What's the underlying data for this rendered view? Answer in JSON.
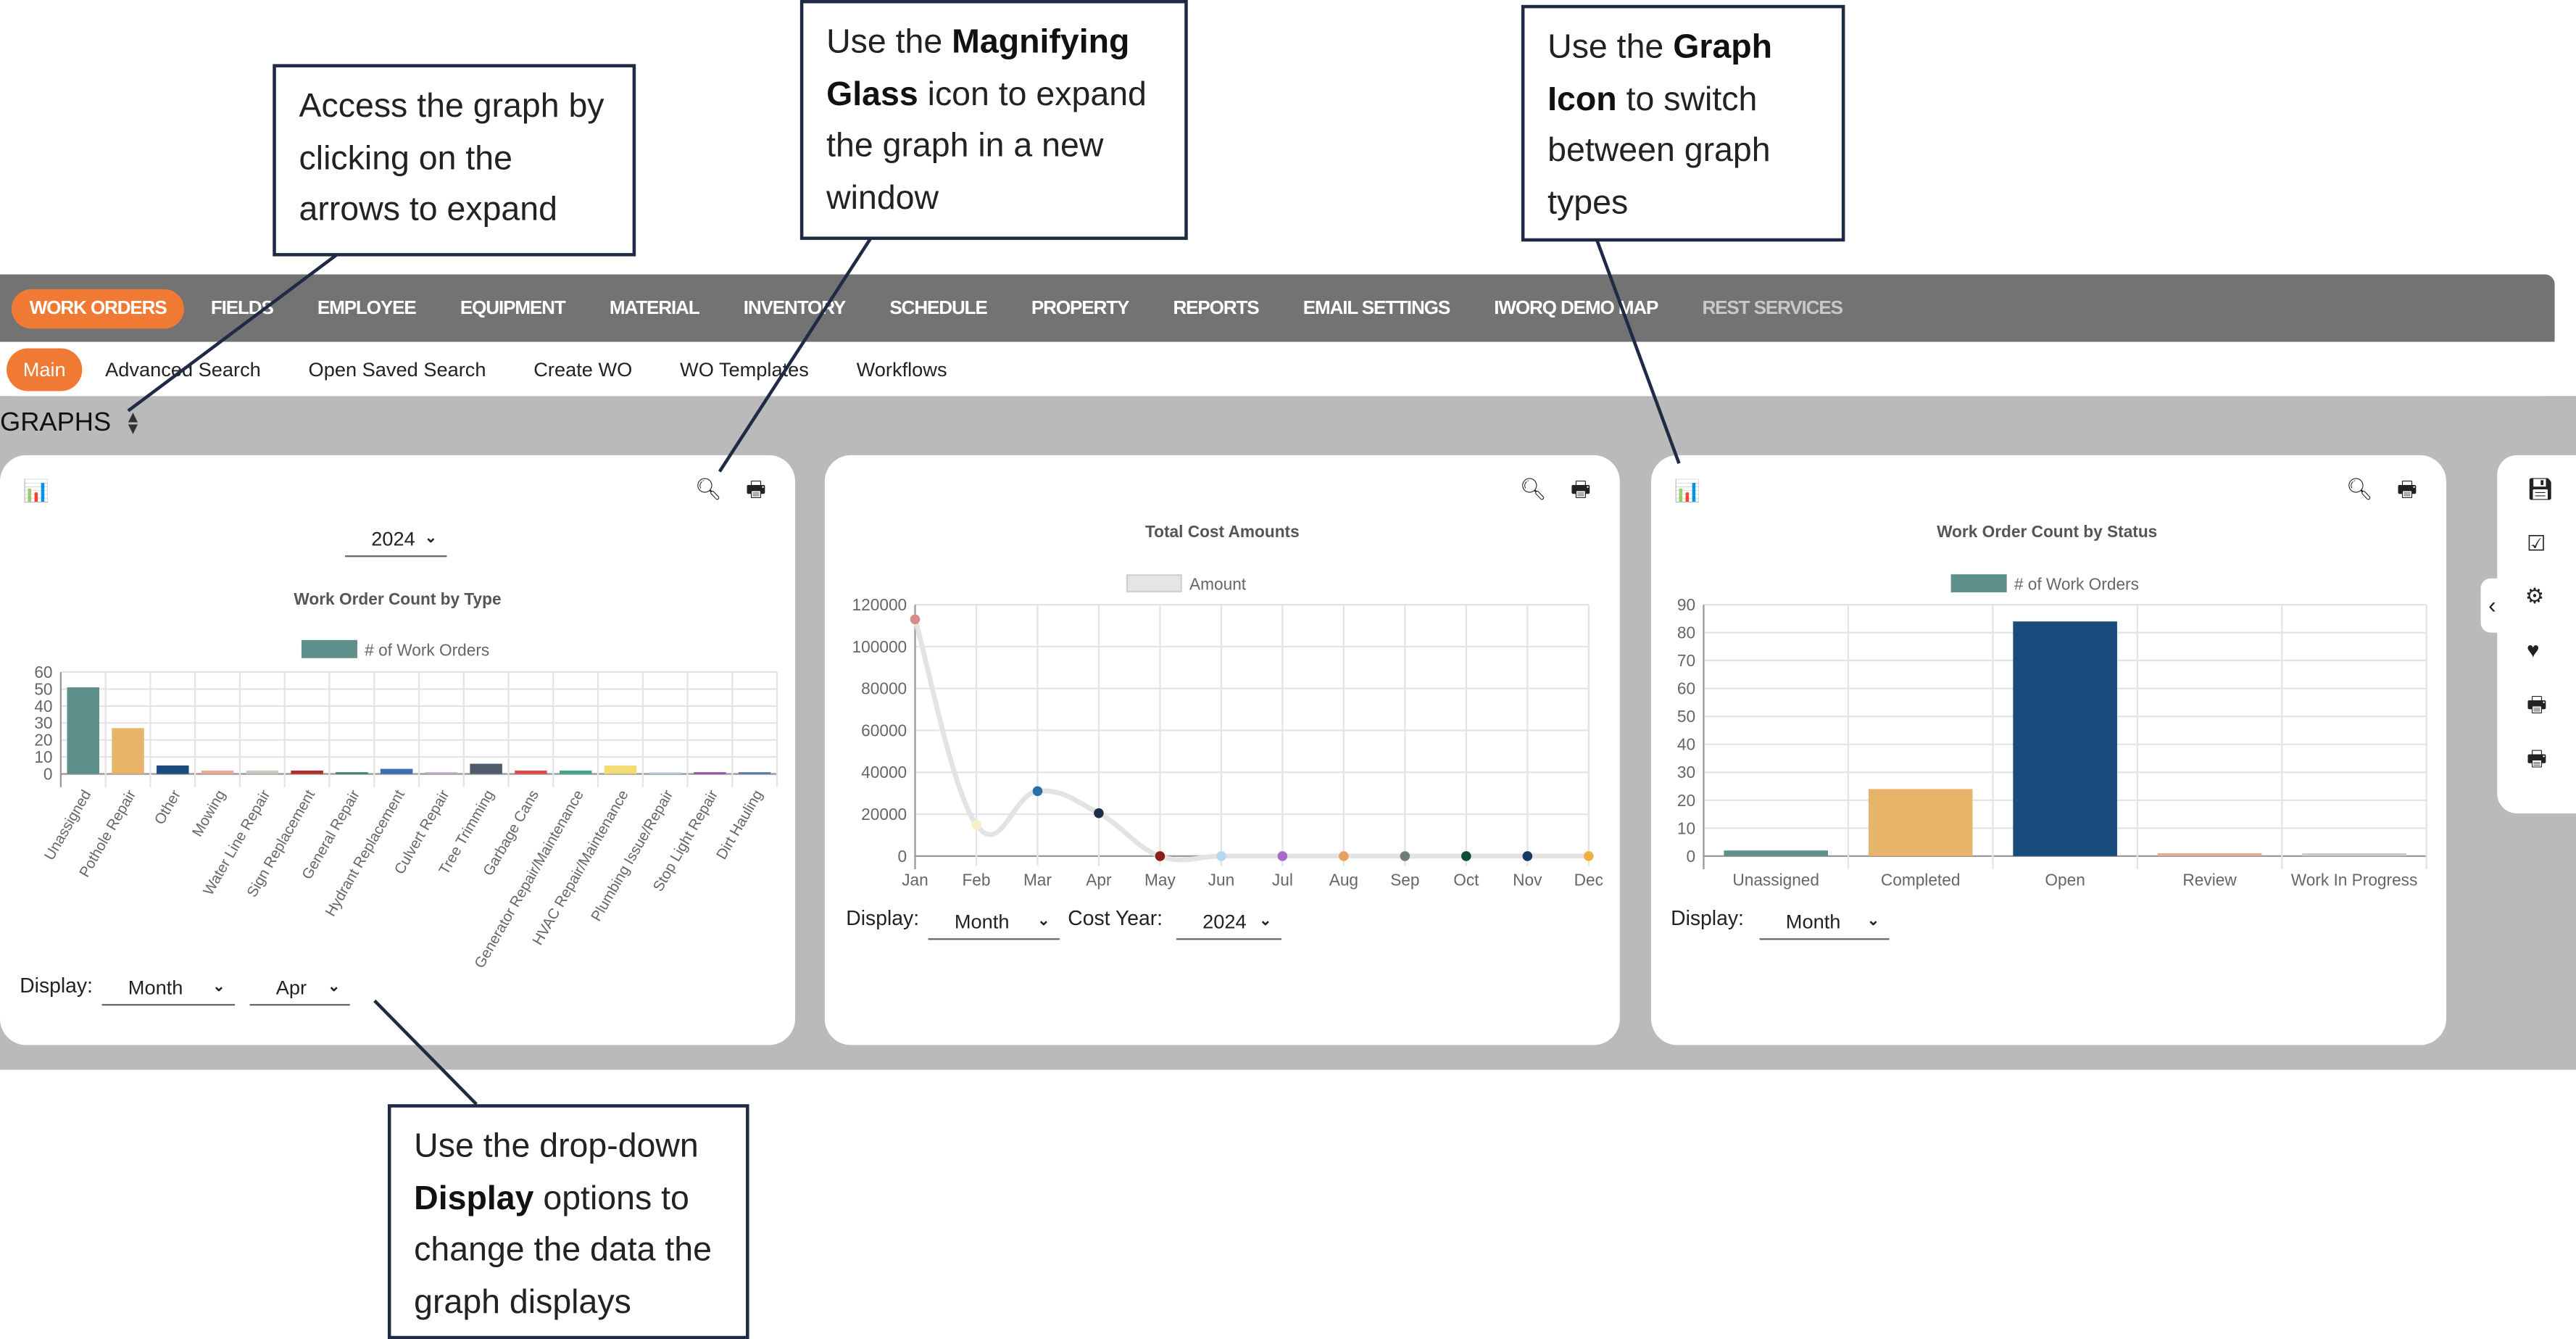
{
  "nav": {
    "items": [
      "WORK ORDERS",
      "FIELDS",
      "EMPLOYEE",
      "EQUIPMENT",
      "MATERIAL",
      "INVENTORY",
      "SCHEDULE",
      "PROPERTY",
      "REPORTS",
      "EMAIL SETTINGS",
      "IWORQ DEMO MAP",
      "REST SERVICES"
    ],
    "active": "WORK ORDERS"
  },
  "subnav": {
    "items": [
      "Main",
      "Advanced Search",
      "Open Saved Search",
      "Create WO",
      "WO Templates",
      "Workflows"
    ],
    "active": "Main"
  },
  "section_title": "GRAPHS",
  "panels": [
    {
      "year_select": "2024",
      "display_label": "Display:",
      "display_select": "Month",
      "month_select": "Apr"
    },
    {
      "display_label": "Display:",
      "display_select": "Month",
      "cost_year_label": "Cost Year:",
      "cost_year_select": "2024"
    },
    {
      "display_label": "Display:",
      "display_select": "Month"
    }
  ],
  "sidebar_icons": [
    "save-icon",
    "checkbox-icon",
    "gears-icon",
    "heart-icon",
    "print-icon",
    "print-icon"
  ],
  "callouts": [
    {
      "parts": [
        "Access the graph by clicking on the arrows to expand"
      ]
    },
    {
      "parts": [
        "Use the ",
        "Magnifying Glass",
        " icon to expand the graph in a new window"
      ]
    },
    {
      "parts": [
        "Use the ",
        "Graph Icon",
        " to switch between graph types"
      ]
    },
    {
      "parts": [
        "Use the drop-down ",
        "Display",
        " options to change the data the graph displays"
      ]
    }
  ],
  "chart_data": [
    {
      "type": "bar",
      "title": "Work Order Count by Type",
      "legend": "# of Work Orders",
      "legend_color": "#5e8f8b",
      "legend_position": "top",
      "grid": true,
      "ylim": [
        0,
        60
      ],
      "yticks": [
        0,
        10,
        20,
        30,
        40,
        50,
        60
      ],
      "categories": [
        "Unassigned",
        "Pothole Repair",
        "Other",
        "Mowing",
        "Water Line Repair",
        "Sign Replacement",
        "General Repair",
        "Hydrant Replacement",
        "Culvert Repair",
        "Tree  Trimming",
        "Garbage Cans",
        "Generator Repair/Maintenance",
        "HVAC Repair/Maintenance",
        "Plumbing Issue/Repair",
        "Stop Light Repair",
        "Dirt Hauling"
      ],
      "values": [
        51,
        27,
        5,
        2,
        2,
        2,
        1,
        3,
        1,
        6,
        2,
        2,
        5,
        1,
        1,
        1
      ],
      "colors": [
        "#5e8f8b",
        "#e6b56a",
        "#1b4a7d",
        "#e8a993",
        "#c9c9c2",
        "#b22a2a",
        "#2e7d5b",
        "#3b6fb5",
        "#c8a6d4",
        "#4f5b6b",
        "#e04848",
        "#3aa58a",
        "#f3dc75",
        "#b9d3e6",
        "#8c4aa8",
        "#4a72a6"
      ]
    },
    {
      "type": "line",
      "title": "Total Cost Amounts",
      "legend": "Amount",
      "legend_color": "#e5e5e5",
      "legend_position": "top",
      "grid": true,
      "ylim": [
        0,
        120000
      ],
      "yticks": [
        0,
        20000,
        40000,
        60000,
        80000,
        100000,
        120000
      ],
      "categories": [
        "Jan",
        "Feb",
        "Mar",
        "Apr",
        "May",
        "Jun",
        "Jul",
        "Aug",
        "Sep",
        "Oct",
        "Nov",
        "Dec"
      ],
      "values": [
        113000,
        15000,
        31000,
        20500,
        0,
        0,
        0,
        0,
        0,
        0,
        0,
        0
      ],
      "colors": [
        "#d98a8a",
        "#f6efc8",
        "#2a6ea6",
        "#1f2f4a",
        "#8b1d1d",
        "#b4d8f0",
        "#a56bc7",
        "#e8a060",
        "#6f7d7a",
        "#0f4a3a",
        "#123a63",
        "#f0b040"
      ]
    },
    {
      "type": "bar",
      "title": "Work Order Count by Status",
      "legend": "# of Work Orders",
      "legend_color": "#5e8f8b",
      "legend_position": "top",
      "grid": true,
      "ylim": [
        0,
        90
      ],
      "yticks": [
        0,
        10,
        20,
        30,
        40,
        50,
        60,
        70,
        80,
        90
      ],
      "categories": [
        "Unassigned",
        "Completed",
        "Open",
        "Review",
        "Work In Progress"
      ],
      "values": [
        2,
        24,
        84,
        1,
        1
      ],
      "colors": [
        "#5e8f8b",
        "#e6b56a",
        "#1b4a7d",
        "#e8a993",
        "#c9c9c2"
      ]
    }
  ]
}
